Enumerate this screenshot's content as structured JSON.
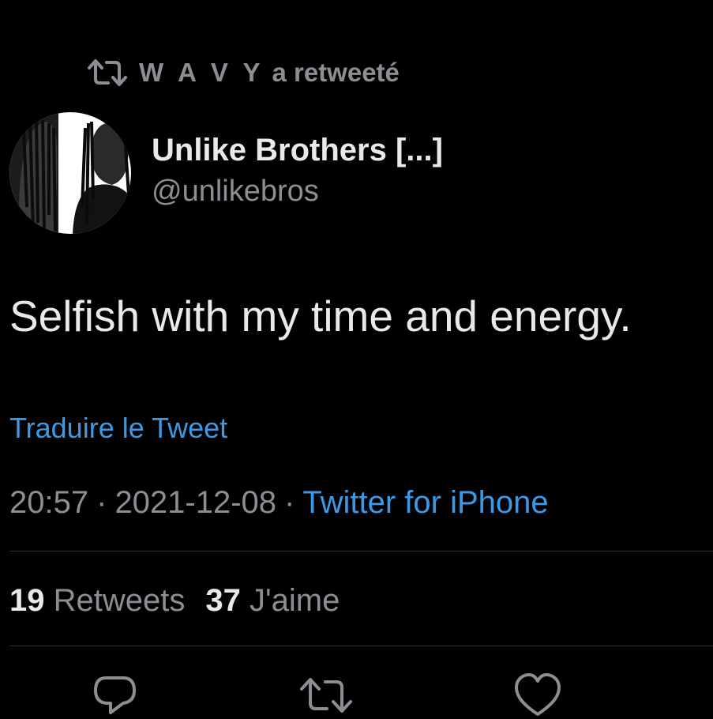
{
  "retweet_context": {
    "icon": "retweet-icon",
    "retweeter": "W A V Y",
    "suffix": "a retweeté"
  },
  "author": {
    "avatar_icon": "avatar",
    "display_name": "Unlike Brothers [...]",
    "handle": "@unlikebros"
  },
  "tweet": {
    "text": "Selfish with my time and energy."
  },
  "translate_label": "Traduire le Tweet",
  "meta": {
    "time": "20:57",
    "separator": "·",
    "date": "2021-12-08",
    "source": "Twitter for iPhone"
  },
  "stats": {
    "retweets_count": "19",
    "retweets_label": "Retweets",
    "likes_count": "37",
    "likes_label": "J'aime"
  },
  "actions": [
    {
      "icon": "reply-icon"
    },
    {
      "icon": "retweet-icon"
    },
    {
      "icon": "like-icon"
    }
  ],
  "colors": {
    "background": "#000000",
    "text_primary": "#e7e9ea",
    "text_secondary": "#8b8f94",
    "link": "#3b9ae8",
    "divider": "#2f3336"
  }
}
